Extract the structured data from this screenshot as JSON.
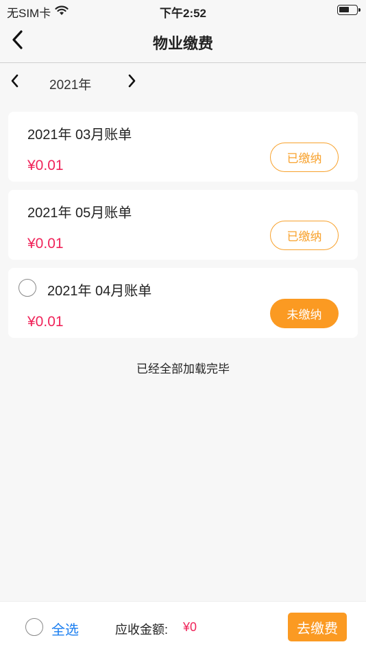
{
  "status_bar": {
    "carrier": "无SIM卡",
    "time": "下午2:52"
  },
  "nav": {
    "title": "物业缴费",
    "back_icon": "chevron-left-icon"
  },
  "year_selector": {
    "year": "2021年",
    "prev_icon": "chevron-left-icon",
    "next_icon": "chevron-right-icon"
  },
  "bills": [
    {
      "title": "2021年 03月账单",
      "amount": "¥0.01",
      "status": "已缴纳",
      "paid": true,
      "selectable": false
    },
    {
      "title": "2021年 05月账单",
      "amount": "¥0.01",
      "status": "已缴纳",
      "paid": true,
      "selectable": false
    },
    {
      "title": "2021年 04月账单",
      "amount": "¥0.01",
      "status": "未缴纳",
      "paid": false,
      "selectable": true
    }
  ],
  "list_footer": "已经全部加载完毕",
  "bottom_bar": {
    "select_all": "全选",
    "total_label": "应收金额:",
    "total_value": "¥0",
    "pay_button": "去缴费"
  },
  "colors": {
    "accent_orange": "#fb9a22",
    "amount_red": "#f0245a",
    "link_blue": "#1a7ef0"
  }
}
